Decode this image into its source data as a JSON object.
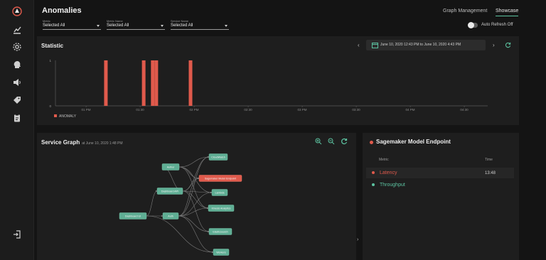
{
  "header": {
    "title": "Anomalies",
    "tabs": [
      {
        "label": "Graph Management",
        "active": false
      },
      {
        "label": "Showcase",
        "active": true
      }
    ],
    "filters": [
      {
        "label": "Metric",
        "value": "Selected All"
      },
      {
        "label": "Metric Name",
        "value": "Selected All"
      },
      {
        "label": "Service Name",
        "value": "Selected All"
      }
    ],
    "auto_refresh_label": "Auto Refresh Off"
  },
  "sidebar": {
    "items": [
      {
        "icon": "logo-icon"
      },
      {
        "icon": "chart-icon"
      },
      {
        "icon": "gear-icon"
      },
      {
        "icon": "head-icon"
      },
      {
        "icon": "speaker-icon"
      },
      {
        "icon": "tag-icon"
      },
      {
        "icon": "clipboard-icon"
      },
      {
        "icon": "logout-icon"
      }
    ]
  },
  "statistic": {
    "title": "Statistic",
    "date_range": "June 10, 2020 12:43 PM to June 10, 2020 4:43 PM"
  },
  "chart_data": {
    "type": "bar",
    "x": [
      "1:11 PM",
      "1:32 PM",
      "1:37 PM",
      "1:39 PM",
      "1:58 PM"
    ],
    "tick_labels": [
      "01 PM",
      "01:30",
      "02 PM",
      "02:30",
      "03 PM",
      "03:30",
      "04 PM",
      "04:30"
    ],
    "series": [
      {
        "name": "ANOMALY",
        "values": [
          1,
          1,
          1,
          1,
          1
        ]
      }
    ],
    "ylim": [
      0,
      1
    ],
    "y_ticks": [
      0,
      1
    ],
    "grid": false,
    "legend_position": "bottom-left",
    "color": "#e05a4c"
  },
  "service_graph": {
    "title": "Service Graph",
    "subtitle": "at June 10, 2020 1:48 PM",
    "nodes": [
      {
        "id": "dashboard",
        "label": "Dashboard UI"
      },
      {
        "id": "dashboard_api",
        "label": "Dashboard API"
      },
      {
        "id": "author",
        "label": "Author"
      },
      {
        "id": "auth",
        "label": "Auth"
      },
      {
        "id": "cloudwatch",
        "label": "CloudWatch"
      },
      {
        "id": "sagemaker",
        "label": "Sagemaker Model Endpoint"
      },
      {
        "id": "lambda",
        "label": "Lambda"
      },
      {
        "id": "kinesis",
        "label": "Kinesis Analytics"
      },
      {
        "id": "elasticsearch",
        "label": "Elasticsearch"
      },
      {
        "id": "workers",
        "label": "Workers"
      }
    ]
  },
  "detail_panel": {
    "title": "Sagemaker Model Endpoint",
    "col_metric": "Metric",
    "col_time": "Time",
    "rows": [
      {
        "metric": "Latency",
        "time": "13:48",
        "color": "#e05a4c"
      },
      {
        "metric": "Throughput",
        "time": "",
        "color": "#5cc2a0"
      }
    ]
  },
  "colors": {
    "accent": "#5cc2a0",
    "alert": "#e05a4c",
    "node_fill": "#5fae94",
    "background": "#141414",
    "panel": "#1e1e1e"
  }
}
